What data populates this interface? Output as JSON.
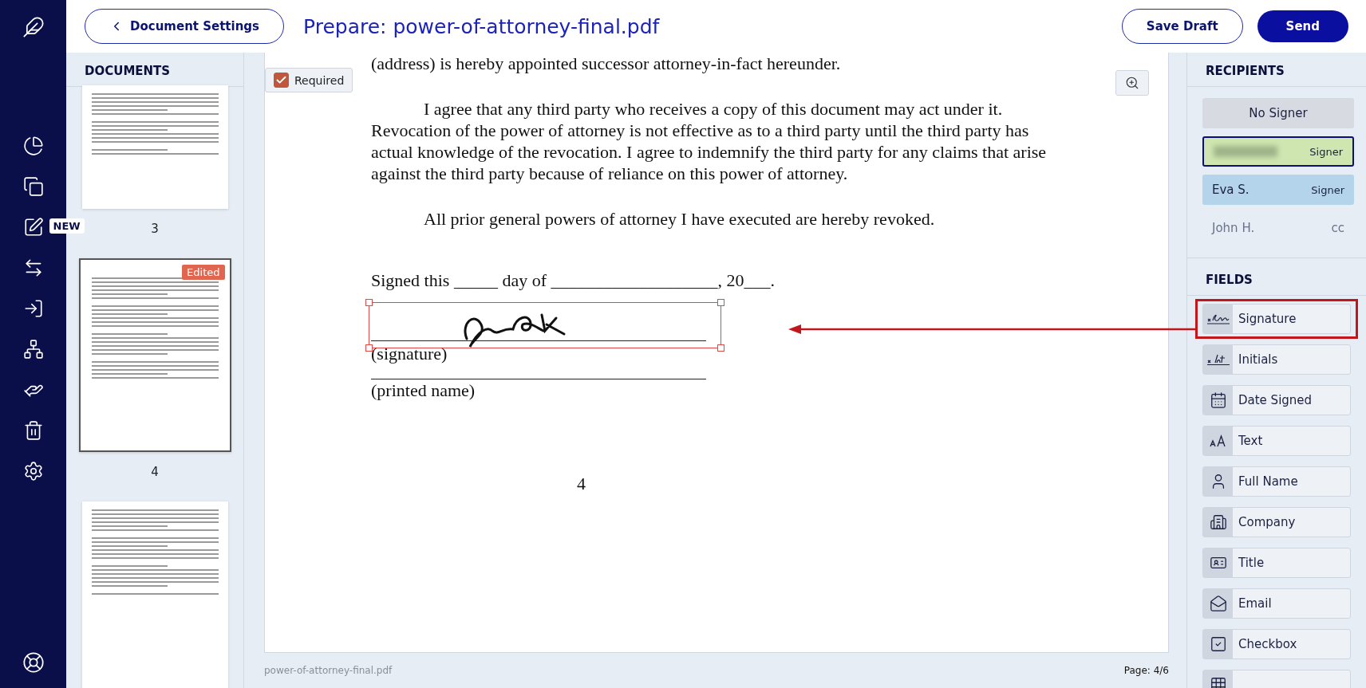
{
  "nav": {
    "items": [
      {
        "kind": "chart"
      },
      {
        "kind": "copy"
      },
      {
        "kind": "edit",
        "badge": "NEW"
      },
      {
        "kind": "swap"
      },
      {
        "kind": "enter"
      },
      {
        "kind": "network"
      },
      {
        "kind": "hand"
      },
      {
        "kind": "trash"
      },
      {
        "kind": "settings"
      }
    ]
  },
  "header": {
    "back_button": "Document Settings",
    "title": "Prepare: power-of-attorney-final.pdf",
    "save_button": "Save Draft",
    "send_button": "Send"
  },
  "documents": {
    "title": "DOCUMENTS",
    "pages": [
      {
        "label": "3",
        "selected": false
      },
      {
        "label": "4",
        "selected": true,
        "badge": "Edited"
      },
      {
        "selected": false
      }
    ]
  },
  "document": {
    "required": {
      "label": "Required",
      "checked": true
    },
    "paragraphs": [
      {
        "kind": "plain",
        "lines": [
          "(address) is hereby appointed successor attorney-in-fact hereunder."
        ]
      },
      {
        "kind": "indent",
        "lines": [
          "I agree that any third party who receives a copy of this document may act under it.",
          "Revocation of the power of attorney is not effective as to a third party until the third party has",
          "actual knowledge of the revocation. I agree to indemnify the third party for any claims that arise",
          "against the third party because of reliance on this power of attorney."
        ]
      },
      {
        "kind": "indent",
        "lines": [
          "All prior general powers of attorney I have executed are hereby revoked."
        ]
      },
      {
        "kind": "signed",
        "lines": [
          "Signed this _____ day of ___________________, 20___."
        ]
      }
    ],
    "signature_caption": "(signature)",
    "name_caption": "(printed name)",
    "page_number": "4",
    "footer_file": "power-of-attorney-final.pdf",
    "footer_page": "Page: 4/6"
  },
  "recipients": {
    "title": "RECIPIENTS",
    "items": [
      {
        "kind": "none",
        "name": "No Signer",
        "selected": false
      },
      {
        "kind": "hidden",
        "role": "Signer",
        "color": "#cfe6b0",
        "selected": true
      },
      {
        "kind": "named",
        "name": "Eva S.",
        "role": "Signer",
        "color": "#b3d4ea",
        "selected": false
      },
      {
        "kind": "plain",
        "name": "John H.",
        "role": "cc",
        "selected": false
      }
    ]
  },
  "fields": {
    "title": "FIELDS",
    "items": [
      {
        "kind": "sign",
        "label": "Signature",
        "highlighted": true
      },
      {
        "kind": "initials",
        "label": "Initials",
        "highlighted": false
      },
      {
        "kind": "calendar",
        "label": "Date Signed",
        "highlighted": false
      },
      {
        "kind": "text",
        "label": "Text",
        "highlighted": false
      },
      {
        "kind": "user",
        "label": "Full Name",
        "highlighted": false
      },
      {
        "kind": "building",
        "label": "Company",
        "highlighted": false
      },
      {
        "kind": "id",
        "label": "Title",
        "highlighted": false
      },
      {
        "kind": "mail",
        "label": "Email",
        "highlighted": false
      },
      {
        "kind": "checkbox",
        "label": "Checkbox",
        "highlighted": false
      },
      {
        "kind": "grid",
        "highlighted": false
      }
    ]
  }
}
